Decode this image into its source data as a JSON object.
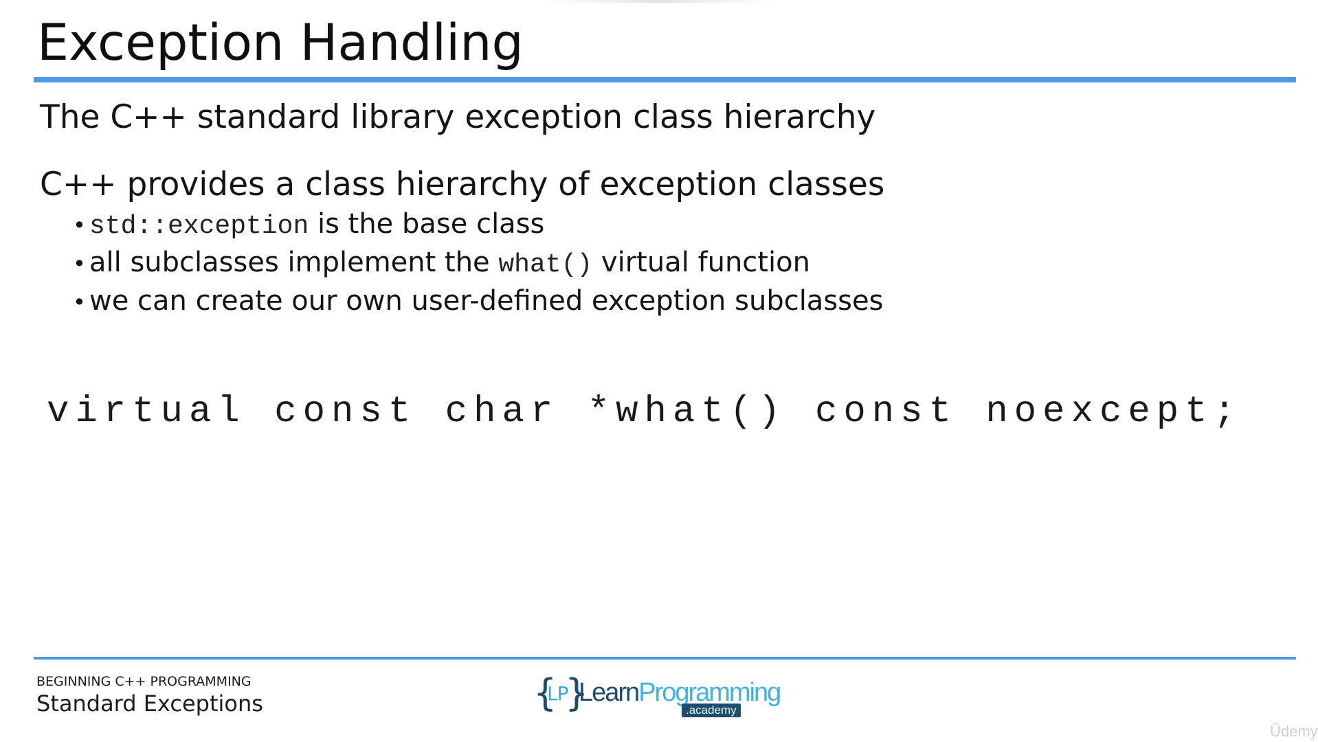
{
  "slide": {
    "title": "Exception Handling",
    "subtitle": "The C++ standard library exception class hierarchy",
    "lead": "C++ provides a class hierarchy of exception classes",
    "bullets": [
      {
        "code": "std::exception",
        "text_after": " is the base class"
      },
      {
        "text_before": "all subclasses implement the ",
        "code": "what()",
        "text_after": " virtual function"
      },
      {
        "text": "we can create our own user-defined exception subclasses"
      }
    ],
    "code_line": "virtual const char *what() const noexcept;"
  },
  "footer": {
    "course": "BEGINNING C++ PROGRAMMING",
    "lecture": "Standard Exceptions"
  },
  "logo": {
    "brace_open": "{",
    "initials": "LP",
    "brace_close": "}",
    "word_learn": "Learn",
    "word_programming": "Programming",
    "academy": ".academy"
  },
  "watermark": "Ûdemy",
  "colors": {
    "accent_rule": "#4e9ae3",
    "logo_dark": "#1e4c6a",
    "logo_light": "#3fb3e6"
  }
}
